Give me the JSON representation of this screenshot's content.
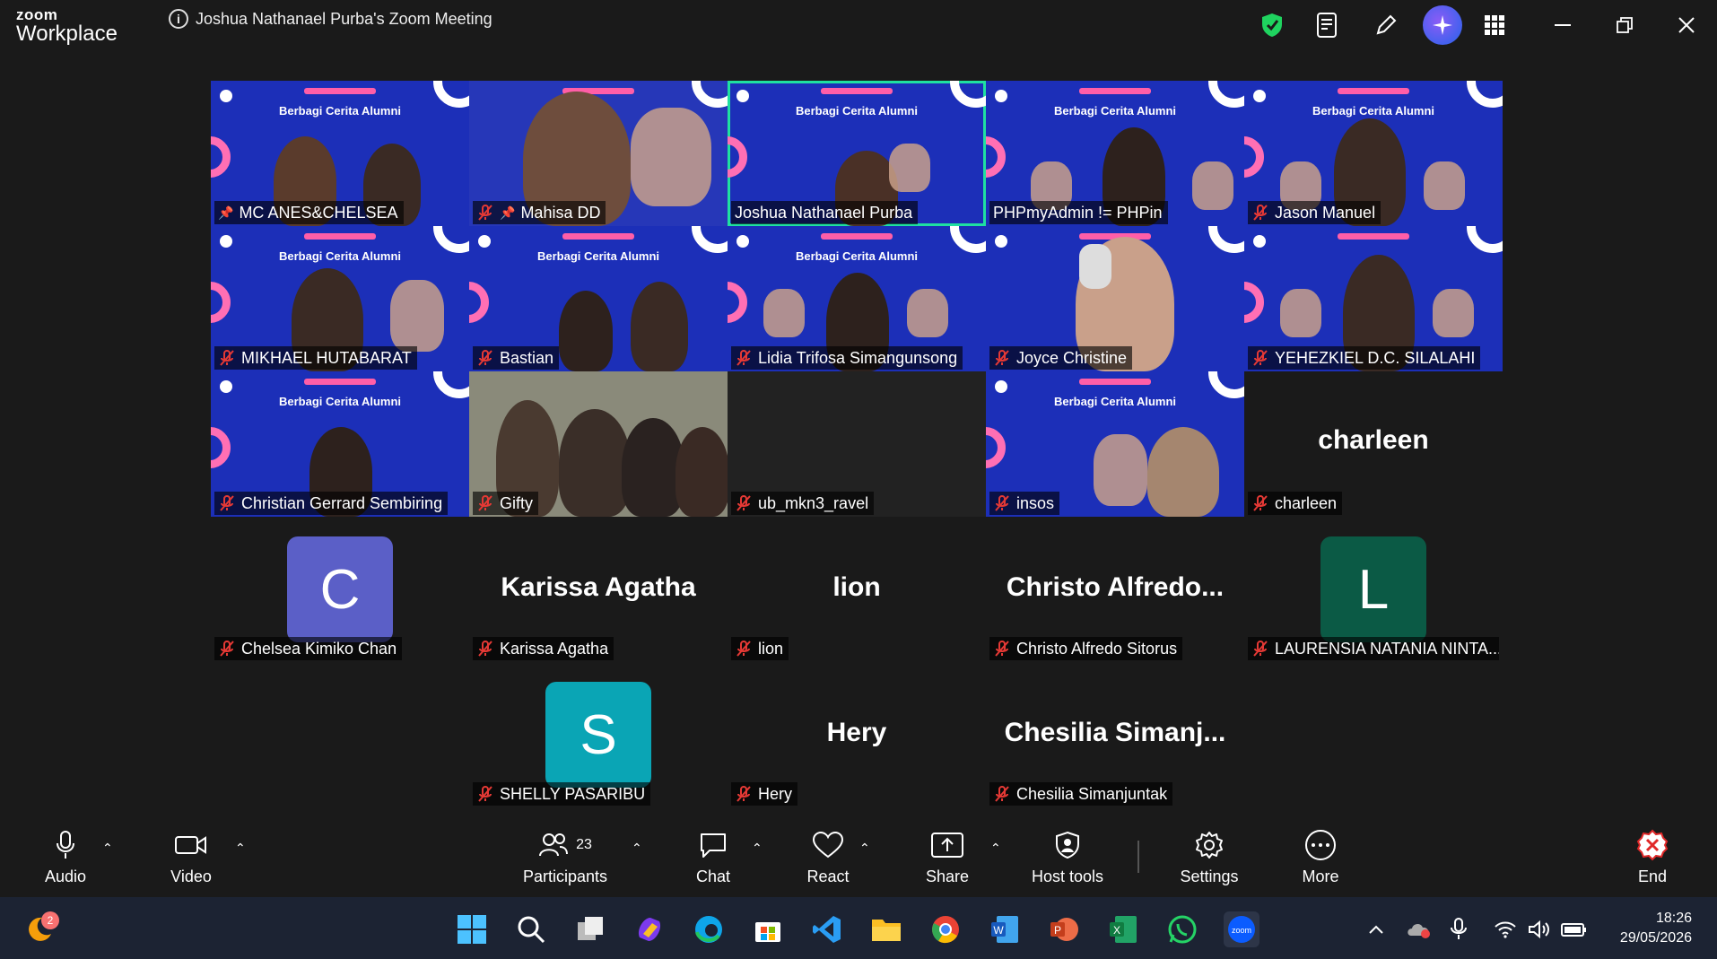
{
  "app": {
    "logo_top": "zoom",
    "logo_bottom": "Workplace",
    "meeting_title": "Joshua Nathanael Purba's Zoom Meeting"
  },
  "banner_text": "Berbagi Cerita Alumni",
  "video_tiles": [
    {
      "name": "MC ANES&CHELSEA",
      "pinned": true,
      "muted": false
    },
    {
      "name": "Mahisa DD",
      "pinned": true,
      "muted": true
    },
    {
      "name": "Joshua Nathanael Purba",
      "pinned": false,
      "muted": false,
      "active": true
    },
    {
      "name": "PHPmyAdmin != PHPin",
      "pinned": false,
      "muted": false
    },
    {
      "name": "Jason Manuel",
      "pinned": false,
      "muted": true
    },
    {
      "name": "MIKHAEL HUTABARAT",
      "muted": true
    },
    {
      "name": "Bastian",
      "muted": true
    },
    {
      "name": "Lidia Trifosa Simangunsong",
      "muted": true
    },
    {
      "name": "Joyce Christine",
      "muted": true
    },
    {
      "name": "YEHEZKIEL D.C. SILALAHI",
      "muted": true
    },
    {
      "name": "Christian Gerrard Sembiring",
      "muted": true
    },
    {
      "name": "Gifty",
      "muted": true
    },
    {
      "name": "ub_mkn3_ravel",
      "muted": true
    },
    {
      "name": "insos",
      "muted": true
    },
    {
      "name": "charleen",
      "muted": true,
      "display": "charleen"
    }
  ],
  "name_tiles": [
    {
      "name": "Chelsea Kimiko Chan",
      "avatar_letter": "C",
      "avatar_color": "#5b5fc7"
    },
    {
      "name": "Karissa Agatha",
      "display": "Karissa Agatha"
    },
    {
      "name": "lion",
      "display": "lion"
    },
    {
      "name": "Christo Alfredo Sitorus",
      "display": "Christo  Alfredo..."
    },
    {
      "name": "LAURENSIA NATANIA NINTA...",
      "avatar_letter": "L",
      "avatar_color": "#0b5a45"
    },
    {
      "name": "SHELLY PASARIBU",
      "avatar_letter": "S",
      "avatar_color": "#0aa5b5"
    },
    {
      "name": "Hery",
      "display": "Hery"
    },
    {
      "name": "Chesilia Simanjuntak",
      "display": "Chesilia  Simanj..."
    }
  ],
  "toolbar": {
    "audio": "Audio",
    "video": "Video",
    "participants": "Participants",
    "participants_count": "23",
    "chat": "Chat",
    "react": "React",
    "share": "Share",
    "host_tools": "Host tools",
    "settings": "Settings",
    "more": "More",
    "end": "End"
  },
  "taskbar": {
    "time": "18:26",
    "date": "29/05/2026",
    "notif_badge": "2"
  },
  "colors": {
    "accent_green": "#1fe0a1",
    "banner_blue": "#1c2fb8",
    "end_red": "#e02828"
  }
}
